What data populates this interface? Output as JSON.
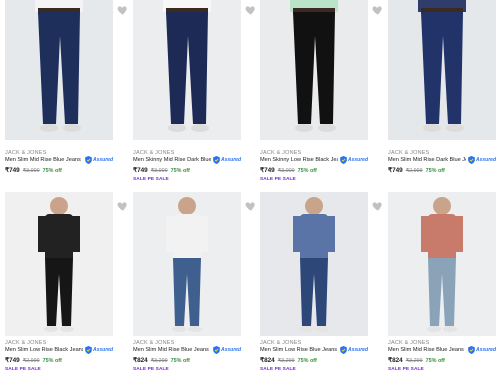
{
  "products": [
    {
      "brand": "JACK & JONES",
      "title": "Men Slim Mid Rise Blue Jeans",
      "price": "₹749",
      "mrp": "₹3,000",
      "off": "75% off",
      "assured": "Assured",
      "sale": "",
      "shirt": "#f4f4f4",
      "jeans": "#1f2f5c",
      "bg": "#e6e9ec"
    },
    {
      "brand": "JACK & JONES",
      "title": "Men Skinny Mid Rise Dark Blue ...",
      "price": "₹749",
      "mrp": "₹3,000",
      "off": "75% off",
      "assured": "Assured",
      "sale": "SALE PE SALE",
      "shirt": "#f7f7f7",
      "jeans": "#1c2a55",
      "bg": "#ebedef"
    },
    {
      "brand": "JACK & JONES",
      "title": "Men Skinny Low Rise Black Jeans",
      "price": "₹749",
      "mrp": "₹3,000",
      "off": "75% off",
      "assured": "Assured",
      "sale": "SALE PE SALE",
      "shirt": "#b9e4c8",
      "jeans": "#111111",
      "bg": "#eaebec"
    },
    {
      "brand": "JACK & JONES",
      "title": "Men Slim Mid Rise Dark Blue Je...",
      "price": "₹749",
      "mrp": "₹2,999",
      "off": "75% off",
      "assured": "Assured",
      "sale": "",
      "shirt": "#2e3d6b",
      "jeans": "#22336a",
      "bg": "#e5e8eb"
    },
    {
      "brand": "JACK & JONES",
      "title": "Men Slim Low Rise Black Jeans",
      "price": "₹749",
      "mrp": "₹2,999",
      "off": "75% off",
      "assured": "Assured",
      "sale": "SALE PE SALE",
      "shirt": "#222222",
      "jeans": "#161616",
      "bg": "#f0f0f0"
    },
    {
      "brand": "JACK & JONES",
      "title": "Men Slim Mid Rise Blue Jeans",
      "price": "₹824",
      "mrp": "₹3,299",
      "off": "75% off",
      "assured": "Assured",
      "sale": "SALE PE SALE",
      "shirt": "#f2f2f2",
      "jeans": "#3f5f8e",
      "bg": "#eceeef"
    },
    {
      "brand": "JACK & JONES",
      "title": "Men Slim Low Rise Blue Jeans",
      "price": "₹824",
      "mrp": "₹3,299",
      "off": "75% off",
      "assured": "Assured",
      "sale": "SALE PE SALE",
      "shirt": "#5a74a8",
      "jeans": "#2d4778",
      "bg": "#e6e8eb"
    },
    {
      "brand": "JACK & JONES",
      "title": "Men Slim Mid Rise Blue Jeans",
      "price": "₹824",
      "mrp": "₹3,299",
      "off": "75% off",
      "assured": "Assured",
      "sale": "SALE PE SALE",
      "shirt": "#c87b6a",
      "jeans": "#8ba3b8",
      "bg": "#eceeef"
    }
  ]
}
